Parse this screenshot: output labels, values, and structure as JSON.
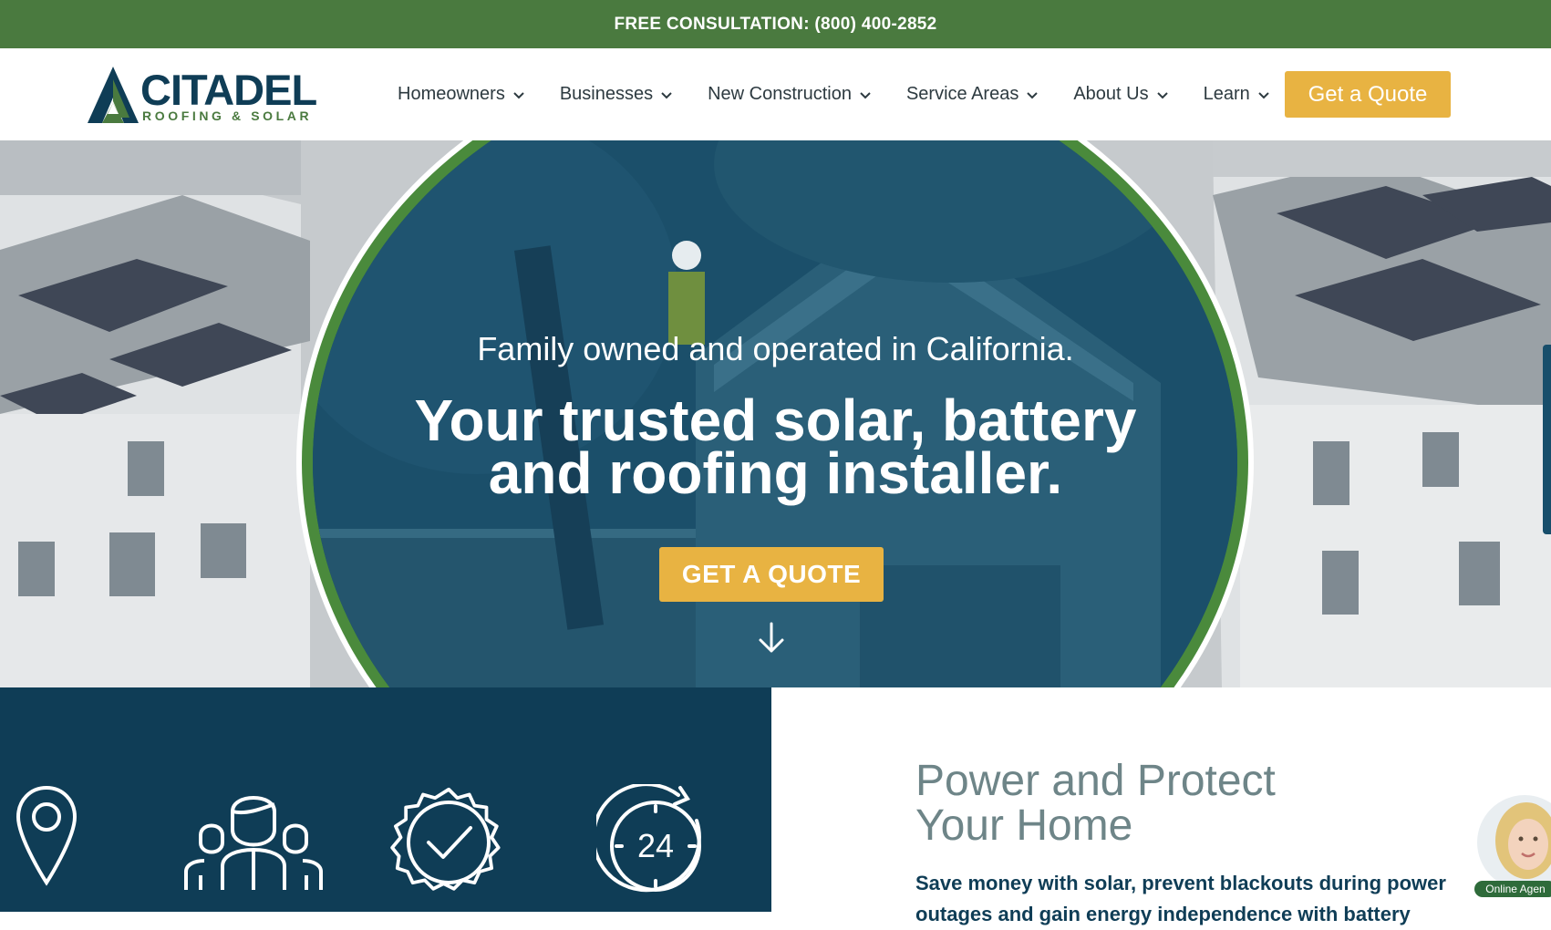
{
  "topbar": {
    "text": "FREE CONSULTATION: (800) 400-2852"
  },
  "logo": {
    "word": "CITADEL",
    "sub": "ROOFING & SOLAR"
  },
  "nav": {
    "items": [
      {
        "label": "Homeowners"
      },
      {
        "label": "Businesses"
      },
      {
        "label": "New Construction"
      },
      {
        "label": "Service Areas"
      },
      {
        "label": "About Us"
      },
      {
        "label": "Learn"
      }
    ],
    "quote_label": "Get a Quote"
  },
  "hero": {
    "subtitle": "Family owned and operated in California.",
    "title_line1": "Your trusted solar, battery",
    "title_line2": "and roofing installer.",
    "button_label": "GET A QUOTE"
  },
  "features": {
    "icons": [
      "location-pin-icon",
      "team-icon",
      "certified-badge-icon",
      "clock-24-icon"
    ],
    "clock_text": "24"
  },
  "info": {
    "title_line1": "Power and Protect",
    "title_line2": "Your Home",
    "text": "Save money with solar, prevent blackouts during power outages and gain energy independence with battery"
  },
  "chat": {
    "badge": "Online Agen"
  },
  "colors": {
    "green": "#4a7a3f",
    "navy": "#0f3d56",
    "gold": "#e8b342"
  }
}
